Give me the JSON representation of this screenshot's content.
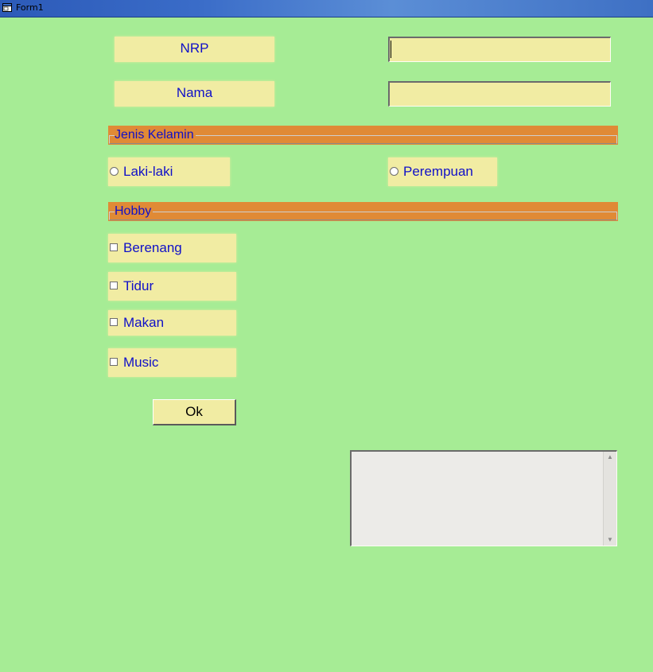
{
  "window": {
    "title": "Form1",
    "icon": "form-icon"
  },
  "labels": {
    "nrp": "NRP",
    "nama": "Nama"
  },
  "inputs": {
    "nrp_value": "",
    "nama_value": ""
  },
  "frames": {
    "gender_title": "Jenis Kelamin",
    "hobby_title": "Hobby"
  },
  "gender_options": [
    "Laki-laki",
    "Perempuan"
  ],
  "hobbies": [
    "Berenang",
    "Tidur",
    "Makan",
    "Music"
  ],
  "ok_button": "Ok",
  "memo": {
    "value": ""
  },
  "colors": {
    "background": "#a6ec95",
    "control": "#f1eca3",
    "frame": "#e08a36",
    "text": "#1010c8",
    "titlebar": "#2c5ab8"
  }
}
